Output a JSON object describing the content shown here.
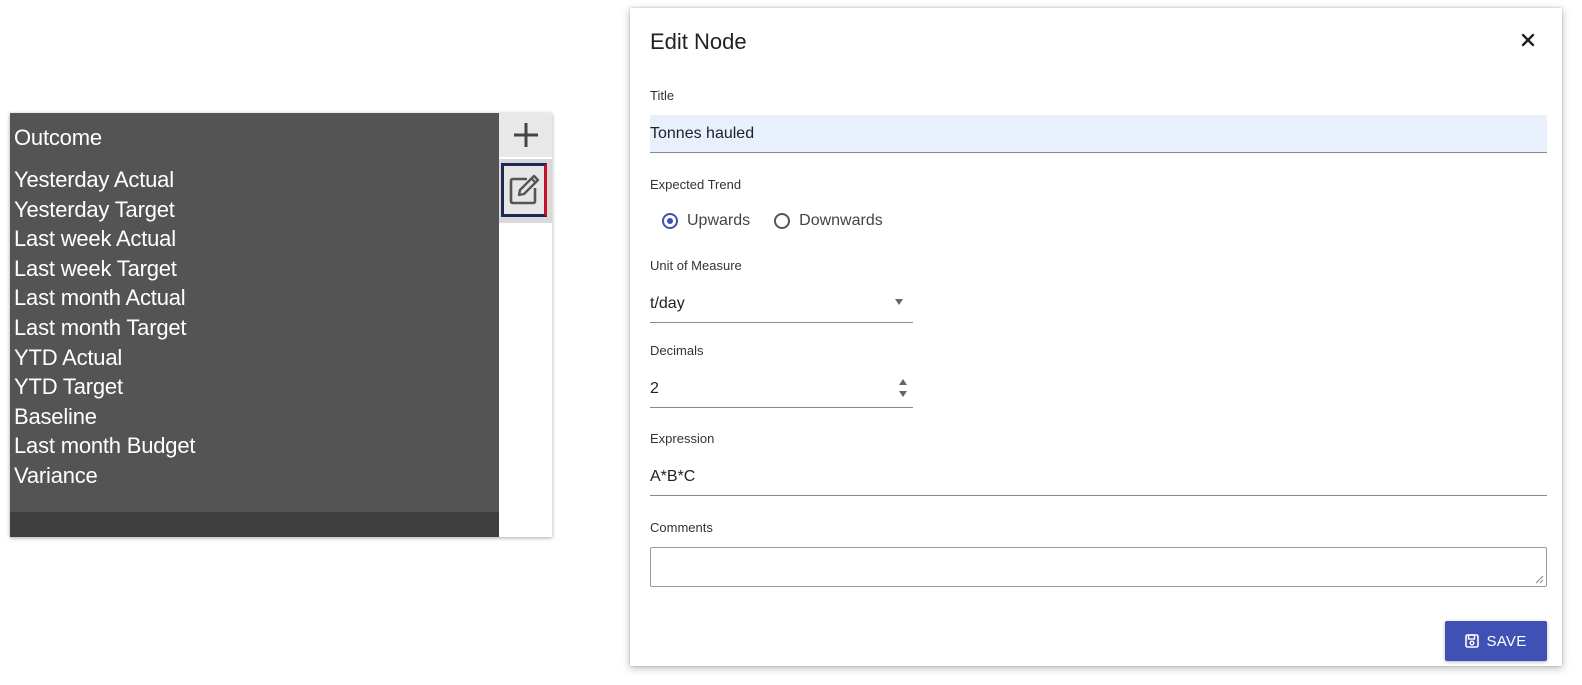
{
  "node_card": {
    "title": "Outcome",
    "metrics": [
      "Yesterday Actual",
      "Yesterday Target",
      "Last week Actual",
      "Last week Target",
      "Last month Actual",
      "Last month Target",
      "YTD Actual",
      "YTD Target",
      "Baseline",
      "Last month Budget",
      "Variance"
    ],
    "tools": {
      "add_icon": "plus-icon",
      "edit_icon": "edit-icon"
    }
  },
  "dialog": {
    "title": "Edit Node",
    "close_icon": "close-icon",
    "title_field": {
      "label": "Title",
      "value": "Tonnes hauled"
    },
    "expected_trend": {
      "label": "Expected Trend",
      "options": [
        {
          "label": "Upwards",
          "checked": true
        },
        {
          "label": "Downwards",
          "checked": false
        }
      ]
    },
    "unit_of_measure": {
      "label": "Unit of Measure",
      "value": "t/day"
    },
    "decimals": {
      "label": "Decimals",
      "value": "2"
    },
    "expression": {
      "label": "Expression",
      "value": "A*B*C"
    },
    "comments": {
      "label": "Comments",
      "value": ""
    },
    "save_button": {
      "label": "SAVE",
      "icon": "save-icon"
    }
  },
  "colors": {
    "node_bg": "#545454",
    "node_footer": "#3f3f3f",
    "accent": "#3f51b5",
    "title_input_bg": "#e8f0fe"
  }
}
